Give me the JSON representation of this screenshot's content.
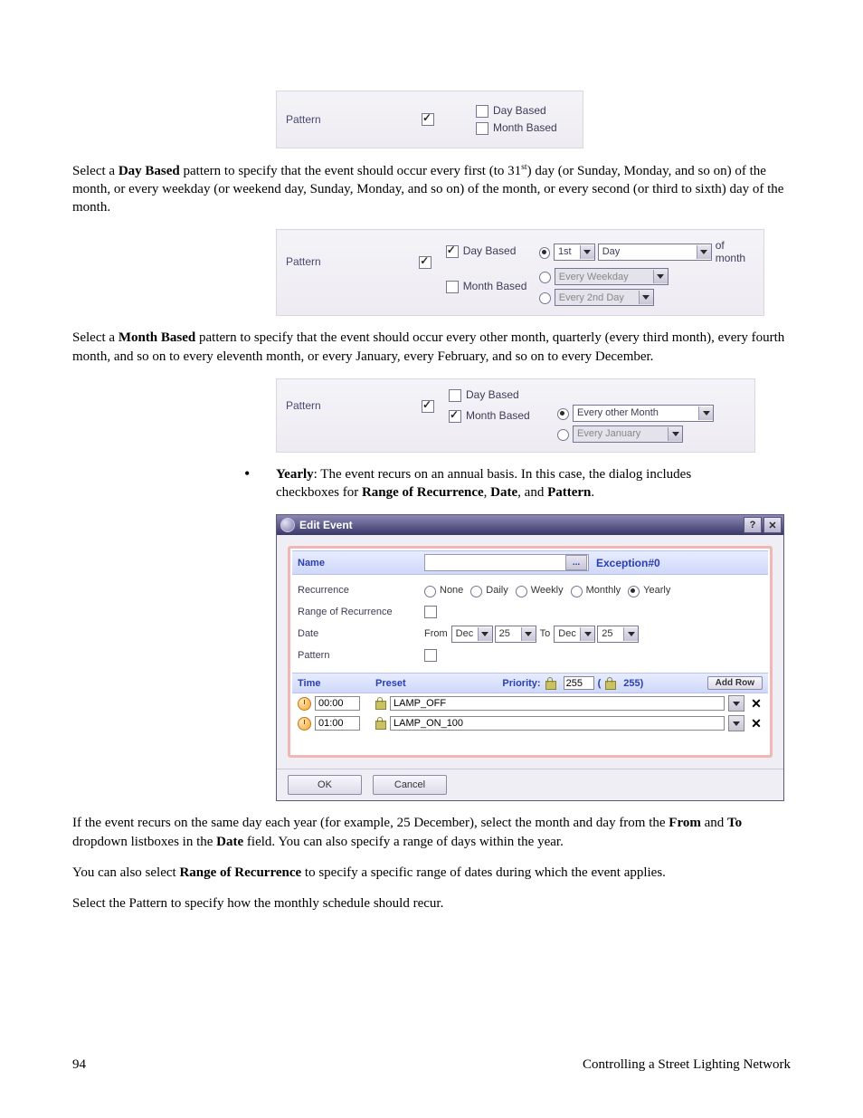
{
  "panel1": {
    "label": "Pattern",
    "enabled": true,
    "day_based_label": "Day Based",
    "day_based_checked": false,
    "month_based_label": "Month Based",
    "month_based_checked": false
  },
  "para1_a": "Select a ",
  "para1_b": "Day Based",
  "para1_c": " pattern to specify that the event should occur every first (to 31",
  "para1_sup": "st",
  "para1_d": ") day (or Sunday, Monday, and so on) of the month, or every weekday (or weekend day, Sunday, Monday, and so on) of the month, or every second (or third to sixth) day of the month.",
  "panel2": {
    "label": "Pattern",
    "enabled": true,
    "day_based_label": "Day Based",
    "day_based_checked": true,
    "month_based_label": "Month Based",
    "month_based_checked": false,
    "opt1_a": "1st",
    "opt1_b": "Day",
    "opt1_suffix": "of month",
    "opt2": "Every Weekday",
    "opt3": "Every 2nd Day"
  },
  "para2_a": "Select a ",
  "para2_b": "Month Based",
  "para2_c": " pattern to specify that the event should occur every other month, quarterly (every third month), every fourth month, and so on to every eleventh month, or every January, every February, and so on to every December.",
  "panel3": {
    "label": "Pattern",
    "enabled": true,
    "day_based_label": "Day Based",
    "day_based_checked": false,
    "month_based_label": "Month Based",
    "month_based_checked": true,
    "opt1": "Every other Month",
    "opt2": "Every January"
  },
  "bullet_yearly_a": "Yearly",
  "bullet_yearly_b": ":  The event recurs on an annual basis.  In this case, the dialog includes checkboxes for ",
  "bullet_yearly_c": "Range of Recurrence",
  "bullet_yearly_d": ", ",
  "bullet_yearly_e": "Date",
  "bullet_yearly_f": ", and ",
  "bullet_yearly_g": "Pattern",
  "bullet_yearly_h": ".",
  "dialog": {
    "title": "Edit Event",
    "help": "?",
    "name_label": "Name",
    "name_value": "Exception#0",
    "recurrence_label": "Recurrence",
    "rec_options": [
      "None",
      "Daily",
      "Weekly",
      "Monthly",
      "Yearly"
    ],
    "rec_selected": "Yearly",
    "range_label": "Range of Recurrence",
    "date_label": "Date",
    "date_from": "From",
    "date_to": "To",
    "date_from_m": "Dec",
    "date_from_d": "25",
    "date_to_m": "Dec",
    "date_to_d": "25",
    "pattern_label": "Pattern",
    "time_label": "Time",
    "preset_label": "Preset",
    "priority_label": "Priority:",
    "priority_val": "255",
    "priority_paren_a": "(",
    "priority_paren_b": "255)",
    "addrow": "Add Row",
    "rows": [
      {
        "time": "00:00",
        "preset": "LAMP_OFF"
      },
      {
        "time": "01:00",
        "preset": "LAMP_ON_100"
      }
    ],
    "ok": "OK",
    "cancel": "Cancel"
  },
  "para3_a": "If the event recurs on the same day each year (for example, 25 December), select the month and day from the ",
  "para3_b": "From",
  "para3_c": " and ",
  "para3_d": "To",
  "para3_e": " dropdown listboxes in the ",
  "para3_f": "Date",
  "para3_g": " field.  You can also specify a range of days within the year.",
  "para4_a": "You can also select ",
  "para4_b": "Range of Recurrence",
  "para4_c": " to specify a specific range of dates during which the event applies.",
  "para5": "Select the Pattern to specify how the monthly schedule should recur.",
  "footer": {
    "page": "94",
    "title": "Controlling a Street Lighting Network"
  }
}
